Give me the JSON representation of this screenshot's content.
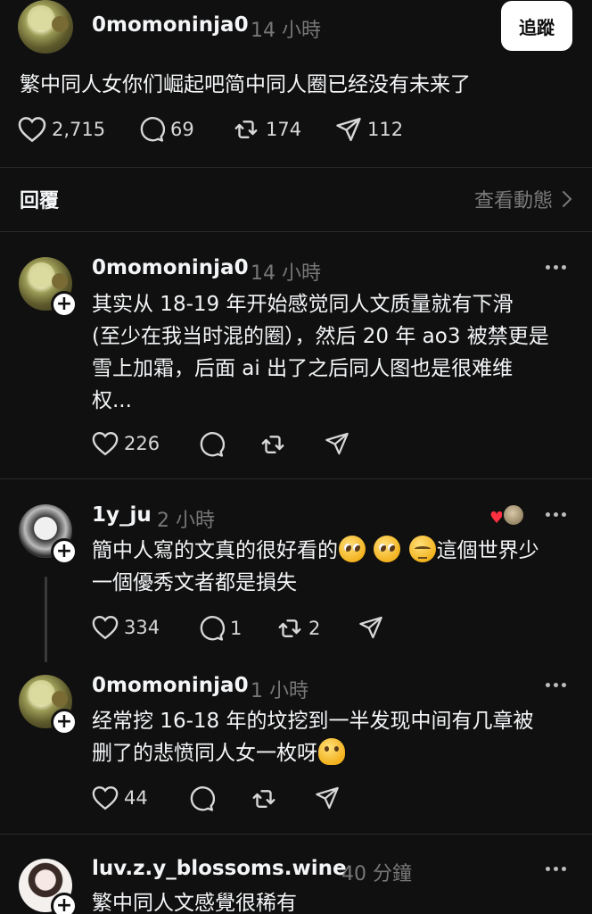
{
  "post": {
    "username": "0momoninja0",
    "time": "14 小時",
    "follow_label": "追蹤",
    "text": "繁中同人女你们崛起吧简中同人圈已经没有未来了",
    "likes": "2,715",
    "comments": "69",
    "reposts": "174",
    "shares": "112"
  },
  "replies_header": {
    "label": "回覆",
    "activity_link": "查看動態"
  },
  "replies": [
    {
      "username": "0momoninja0",
      "time": "14 小時",
      "lines": [
        "其实从 18-19 年开始感觉同人文质量就有下滑",
        "(至少在我当时混的圈），然后 20 年 ao3 被禁更是",
        "雪上加霜，后面 ai 出了之后同人图也是很难维",
        "权..."
      ],
      "likes": "226",
      "comments": "",
      "reposts": ""
    },
    {
      "username": "1y_ju",
      "time": "2 小時",
      "line1_a": "簡中人寫的文真的很好看的",
      "line1_b": "這個世界少",
      "line2": "一個優秀文者都是損失",
      "likes": "334",
      "comments": "1",
      "reposts": "2"
    },
    {
      "username": "0momoninja0",
      "time": "1 小時",
      "line1": "经常挖 16-18 年的坟挖到一半发现中间有几章被",
      "line2": "删了的悲愤同人女一枚呀",
      "likes": "44"
    },
    {
      "username": "luv.z.y_blossoms.wine",
      "time": "40 分鐘",
      "line1": "繁中同人文感覺很稀有"
    }
  ],
  "icons": [
    "heart-icon",
    "comment-icon",
    "repost-icon",
    "share-icon",
    "chevron-right-icon",
    "more-icon",
    "follow-plus-icon"
  ],
  "colors": {
    "background": "#101010",
    "text": "#f3f5f7",
    "muted": "#777777",
    "like_red": "#ff3040"
  }
}
